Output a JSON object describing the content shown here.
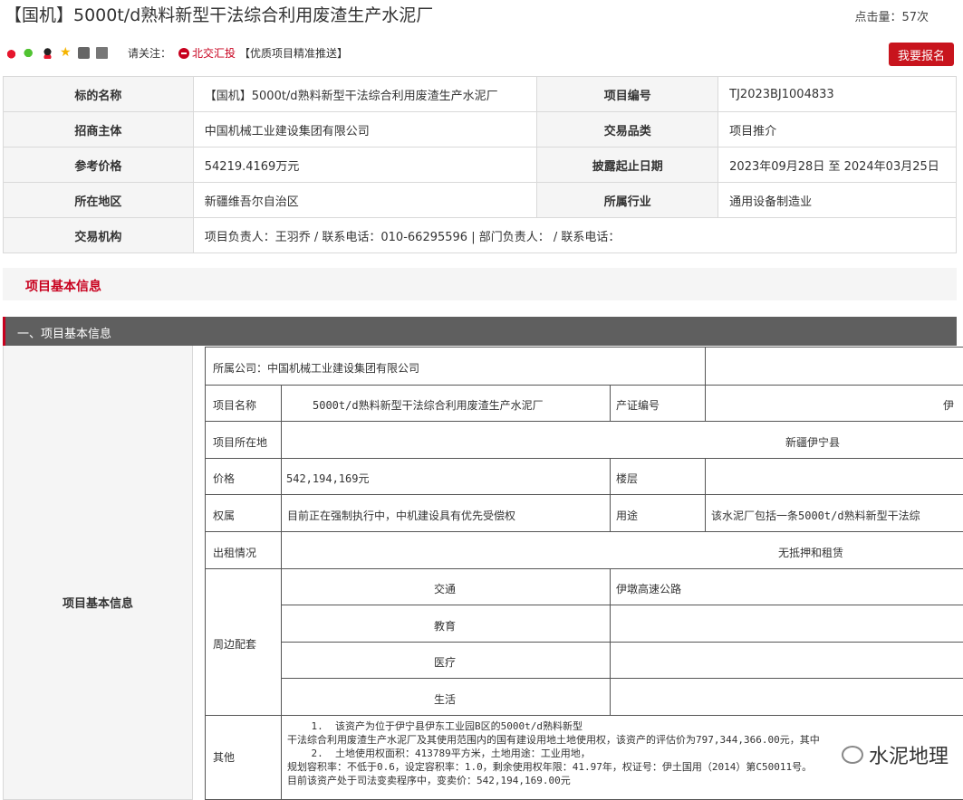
{
  "header": {
    "title": "【国机】5000t/d熟料新型干法综合利用废渣生产水泥厂",
    "clicks": "点击量：57次"
  },
  "share": {
    "icons": [
      "weibo-icon",
      "wechat-icon",
      "qq-icon",
      "star-icon",
      "edit-icon",
      "print-icon"
    ],
    "follow_label": "请关注：",
    "bjhb": "北交汇投",
    "promo": "【优质项目精准推送】",
    "signup": "我要报名"
  },
  "info": {
    "rows": [
      {
        "l1": "标的名称",
        "v1": "【国机】5000t/d熟料新型干法综合利用废渣生产水泥厂",
        "l2": "项目编号",
        "v2": "TJ2023BJ1004833"
      },
      {
        "l1": "招商主体",
        "v1": "中国机械工业建设集团有限公司",
        "l2": "交易品类",
        "v2": "项目推介"
      },
      {
        "l1": "参考价格",
        "v1": "54219.4169万元",
        "l2": "披露起止日期",
        "v2": "2023年09月28日 至 2024年03月25日"
      },
      {
        "l1": "所在地区",
        "v1": "新疆维吾尔自治区",
        "l2": "所属行业",
        "v2": "通用设备制造业"
      }
    ],
    "agency_label": "交易机构",
    "agency_value": "项目负责人：王羽乔 / 联系电话：010-66295596 | 部门负责人： / 联系电话："
  },
  "section": {
    "title": "项目基本信息",
    "subtitle": "一、项目基本信息",
    "left_label": "项目基本信息"
  },
  "detail": {
    "company": "所属公司：中国机械工业建设集团有限公司",
    "name_label": "项目名称",
    "name_value": "5000t/d熟料新型干法综合利用废渣生产水泥厂",
    "cert_label": "产证编号",
    "cert_value": "伊",
    "location_label": "项目所在地",
    "location_value": "新疆伊宁县",
    "price_label": "价格",
    "price_value": "542,194,169元",
    "floor_label": "楼层",
    "ownership_label": "权属",
    "ownership_value": "目前正在强制执行中，中机建设具有优先受偿权",
    "use_label": "用途",
    "use_value": "该水泥厂包括一条5000t/d熟料新型干法综",
    "rent_label": "出租情况",
    "rent_value": "无抵押和租赁",
    "surround_label": "周边配套",
    "traffic_label": "交通",
    "traffic_value": "伊墩高速公路",
    "edu_label": "教育",
    "medical_label": "医疗",
    "life_label": "生活",
    "other_label": "其他",
    "other_lines": [
      "    1.  该资产为位于伊宁县伊东工业园B区的5000t/d熟料新型",
      "干法综合利用废渣生产水泥厂及其使用范围内的国有建设用地土地使用权，该资产的评估价为797,344,366.00元，其中",
      "    2.  土地使用权面积：413789平方米，土地用途：工业用地，",
      "规划容积率：不低于0.6，设定容积率：1.0，剩余使用权年限：41.97年，权证号：伊土国用（2014）第C50011号。",
      "目前该资产处于司法变卖程序中，变卖价：542,194,169.00元"
    ]
  },
  "watermark": "水泥地理"
}
